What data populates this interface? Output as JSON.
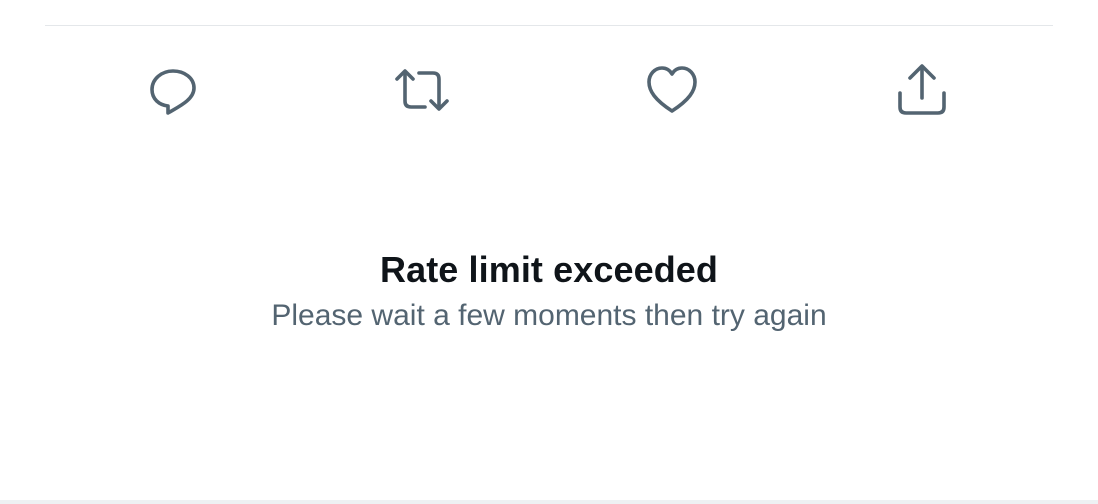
{
  "actions": {
    "reply": {
      "icon": "reply-icon"
    },
    "retweet": {
      "icon": "retweet-icon"
    },
    "like": {
      "icon": "heart-icon"
    },
    "share": {
      "icon": "share-icon"
    }
  },
  "error": {
    "title": "Rate limit exceeded",
    "subtitle": "Please wait a few moments then try again"
  },
  "colors": {
    "icon": "#536471",
    "title": "#0f1419",
    "subtitle": "#536471",
    "divider": "#e4e7ea",
    "background": "#ffffff"
  }
}
